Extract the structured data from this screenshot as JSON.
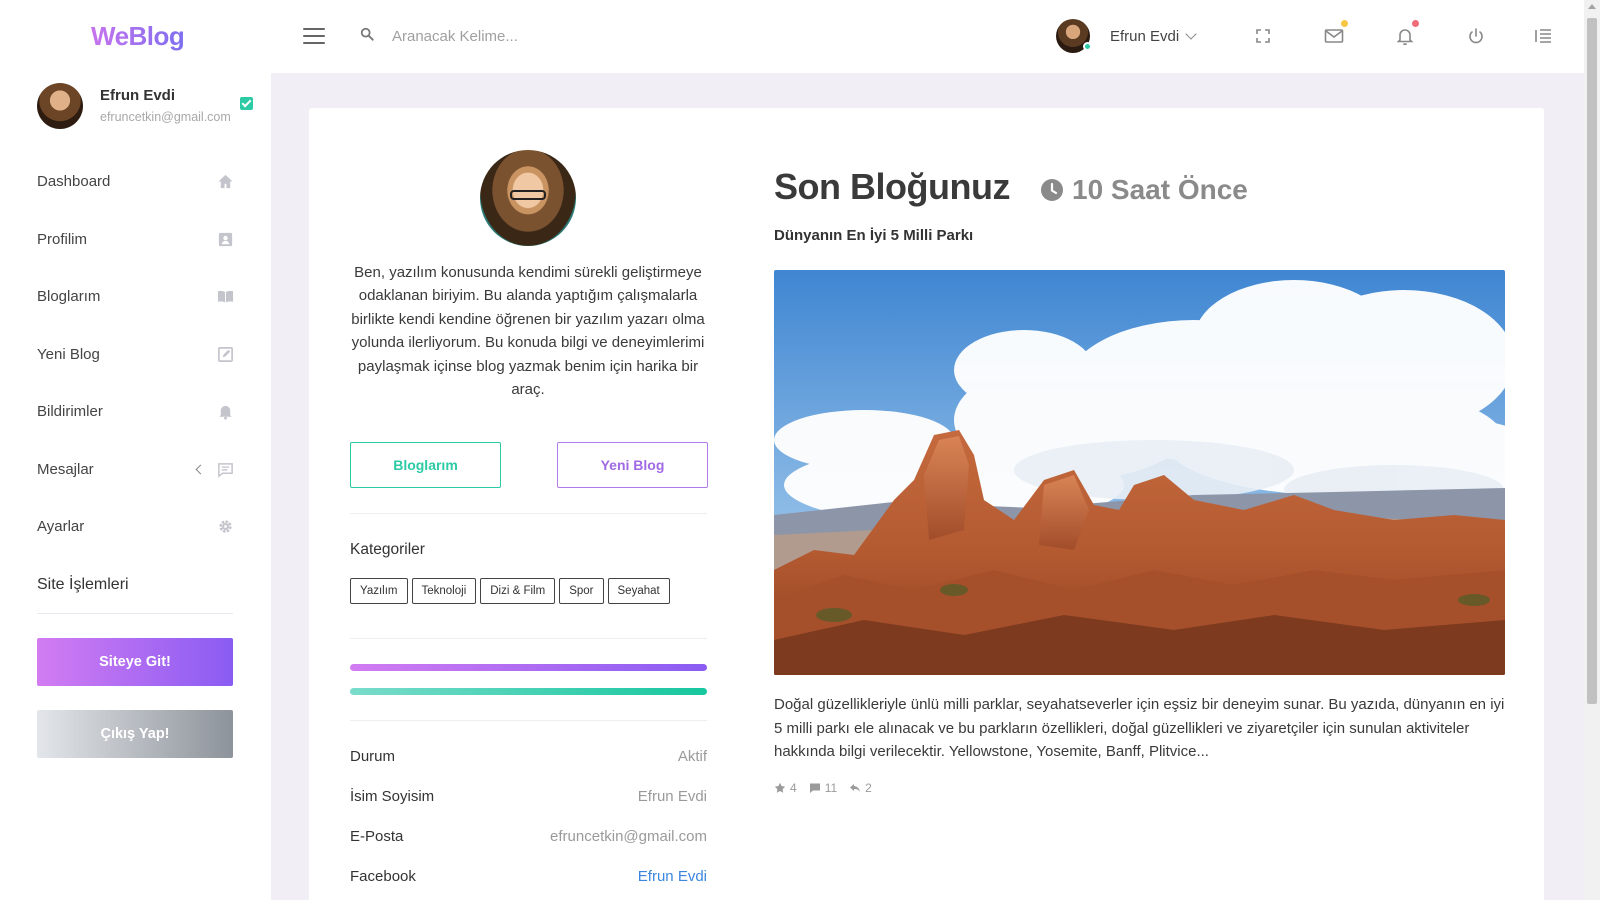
{
  "app": {
    "logo": "WeBlog"
  },
  "header": {
    "search_placeholder": "Aranacak Kelime...",
    "user_name": "Efrun Evdi",
    "icons": [
      "fullscreen-icon",
      "mail-icon",
      "bell-icon",
      "power-icon",
      "list-indent-icon"
    ],
    "colors": {
      "mail_dot": "#f7c744",
      "bell_dot": "#f26b7a",
      "online": "#2ccaa5"
    }
  },
  "sidebar": {
    "profile": {
      "name": "Efrun Evdi",
      "email": "efruncetkin@gmail.com"
    },
    "items": [
      {
        "label": "Dashboard",
        "icon": "home-icon"
      },
      {
        "label": "Profilim",
        "icon": "profile-card-icon"
      },
      {
        "label": "Bloglarım",
        "icon": "book-icon"
      },
      {
        "label": "Yeni Blog",
        "icon": "edit-icon"
      },
      {
        "label": "Bildirimler",
        "icon": "bell-icon"
      },
      {
        "label": "Mesajlar",
        "icon": "message-icon"
      },
      {
        "label": "Ayarlar",
        "icon": "gear-icon"
      }
    ],
    "section_title": "Site İşlemleri",
    "site_button": "Siteye Git!",
    "exit_button": "Çıkış Yap!"
  },
  "profile_panel": {
    "bio": "Ben, yazılım konusunda kendimi sürekli geliştirmeye odaklanan biriyim. Bu alanda yaptığım çalışmalarla birlikte kendi kendine öğrenen bir yazılım yazarı olma yolunda ilerliyorum. Bu konuda bilgi ve deneyimlerimi paylaşmak içinse blog yazmak benim için harika bir araç.",
    "blogs_button": "Bloglarım",
    "new_blog_button": "Yeni Blog",
    "categories_title": "Kategoriler",
    "categories": [
      "Yazılım",
      "Teknoloji",
      "Dizi & Film",
      "Spor",
      "Seyahat"
    ],
    "info": [
      {
        "key": "Durum",
        "value": "Aktif"
      },
      {
        "key": "İsim Soyisim",
        "value": "Efrun Evdi"
      },
      {
        "key": "E-Posta",
        "value": "efruncetkin@gmail.com"
      },
      {
        "key": "Facebook",
        "value": "Efrun Evdi"
      }
    ],
    "colors": {
      "accent_green": "#2ccaa5",
      "accent_purple": "#a06ae4",
      "link": "#3a86e0"
    }
  },
  "latest_blog": {
    "heading": "Son Bloğunuz",
    "time": "10 Saat Önce",
    "title": "Dünyanın En İyi 5 Milli Parkı",
    "image_desc": "desert-rock-formations-image",
    "excerpt": "Doğal güzellikleriyle ünlü milli parklar, seyahatseverler için eşsiz bir deneyim sunar. Bu yazıda, dünyanın en iyi 5 milli parkı ele alınacak ve bu parkların özellikleri, doğal güzellikleri ve ziyaretçiler için sunulan aktiviteler hakkında bilgi verilecektir. Yellowstone, Yosemite, Banff, Plitvice...",
    "stats": {
      "stars": "4",
      "comments": "11",
      "shares": "2"
    }
  }
}
